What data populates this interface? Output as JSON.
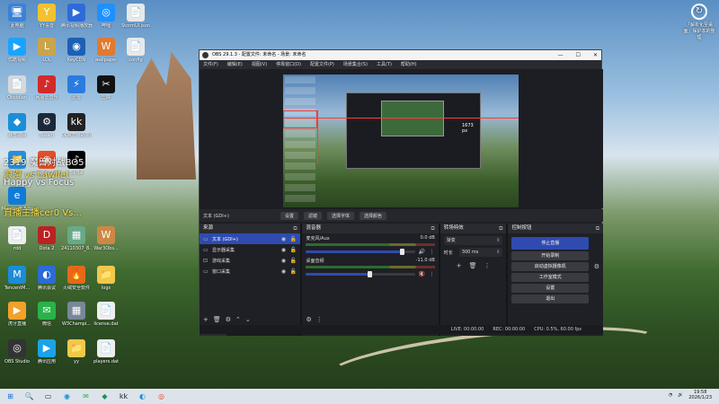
{
  "desktop": {
    "icons": [
      {
        "label": "此电脑",
        "glyph": "🖥",
        "color": "#3b82d6"
      },
      {
        "label": "YY语音",
        "glyph": "Y",
        "color": "#f2c230"
      },
      {
        "label": "腾讯视频播放器",
        "glyph": "▶",
        "color": "#2f6bd8"
      },
      {
        "label": "哔哩",
        "glyph": "◎",
        "color": "#1e90ff"
      },
      {
        "label": "StormUI.json",
        "glyph": "📄",
        "color": "#e8e8e8"
      },
      {
        "label": "优酷视频",
        "glyph": "▶",
        "color": "#1aa3ff"
      },
      {
        "label": "LOL",
        "glyph": "L",
        "color": "#c9a44a"
      },
      {
        "label": "KeyCDN",
        "glyph": "◉",
        "color": "#1d5fb5"
      },
      {
        "label": "wallpaper",
        "glyph": "W",
        "color": "#e07a2f"
      },
      {
        "label": "config",
        "glyph": "📄",
        "color": "#e8e8e8"
      },
      {
        "label": "Obsidian",
        "glyph": "📄",
        "color": "#d8d8d8"
      },
      {
        "label": "网易云音乐",
        "glyph": "♪",
        "color": "#d22a2a"
      },
      {
        "label": "迅雷",
        "glyph": "⚡",
        "color": "#2a7be0"
      },
      {
        "label": "剪映",
        "glyph": "✂",
        "color": "#111"
      },
      {
        "label": "暴雪战网",
        "glyph": "◆",
        "color": "#1a8fd8"
      },
      {
        "label": "Steam",
        "glyph": "⚙",
        "color": "#1b2838"
      },
      {
        "label": "KK官方对战平台",
        "glyph": "kk",
        "color": "#222"
      },
      {
        "label": "文件",
        "glyph": "📁",
        "color": "#2a8cd8"
      },
      {
        "label": "Google Chrome",
        "glyph": "◉",
        "color": "#e44d26"
      },
      {
        "label": "TikTok",
        "glyph": "♪",
        "color": "#000"
      },
      {
        "label": "Microsoft Edge",
        "glyph": "e",
        "color": "#0f7bd8"
      },
      {
        "label": "rdd",
        "glyph": "📄",
        "color": "#eee"
      },
      {
        "label": "Dota 2",
        "glyph": "D",
        "color": "#b22"
      },
      {
        "label": "24110307_8...",
        "glyph": "▦",
        "color": "#6a8"
      },
      {
        "label": "War3Obs...",
        "glyph": "W",
        "color": "#c84"
      },
      {
        "label": "TencentM...",
        "glyph": "M",
        "color": "#1a8cd8"
      },
      {
        "label": "腾讯会议",
        "glyph": "◐",
        "color": "#2a6bd8"
      },
      {
        "label": "火绒安全软件",
        "glyph": "🔥",
        "color": "#e46a1a"
      },
      {
        "label": "logs",
        "glyph": "📁",
        "color": "#f2c84b"
      },
      {
        "label": "虎牙直播",
        "glyph": "▶",
        "color": "#f2a12a"
      },
      {
        "label": "微信",
        "glyph": "✉",
        "color": "#2ab24a"
      },
      {
        "label": "W3Champi...",
        "glyph": "▦",
        "color": "#789"
      },
      {
        "label": "license.dat",
        "glyph": "📄",
        "color": "#eee"
      },
      {
        "label": "OBS Studio",
        "glyph": "◎",
        "color": "#333"
      },
      {
        "label": "腾讯应用",
        "glyph": "▶",
        "color": "#1aa3e8"
      },
      {
        "label": "yy",
        "glyph": "📁",
        "color": "#f2c84b"
      },
      {
        "label": "players.dat",
        "glyph": "📄",
        "color": "#eee"
      }
    ],
    "overlay_lines": [
      "2319 魔兽对战BO5",
      "浪漫 vs Lawliet",
      "Happy vs Focus",
      "直播主播cer0 Vs..."
    ],
    "recycle_bin": {
      "label": "「解析化至桌面」保护本的整理",
      "glyph": "↻"
    }
  },
  "obs": {
    "title": "OBS 29.1.3 - 配置文件: 未命名 - 场景: 未命名",
    "window_controls": [
      "—",
      "☐",
      "✕"
    ],
    "menu": [
      "文件(F)",
      "编辑(E)",
      "视图(V)",
      "停靠窗口(D)",
      "配置文件(P)",
      "场景集合(S)",
      "工具(T)",
      "帮助(H)"
    ],
    "preview_px_label": "1673 px",
    "source_toolbar": {
      "source_name": "文本 (GDI+)",
      "buttons": [
        "设置",
        "滤镜",
        "选择字体",
        "选择颜色"
      ]
    },
    "sources": {
      "title": "来源",
      "items": [
        {
          "name": "文本 (GDI+)",
          "icon": "text-icon",
          "glyph": "▭",
          "selected": true
        },
        {
          "name": "显示器采集",
          "icon": "monitor-icon",
          "glyph": "▭",
          "selected": false
        },
        {
          "name": "游戏采集",
          "icon": "gamepad-icon",
          "glyph": "⊡",
          "selected": false
        },
        {
          "name": "窗口采集",
          "icon": "window-icon",
          "glyph": "▭",
          "selected": false
        }
      ],
      "footer_buttons": [
        "+",
        "🗑",
        "⚙",
        "⌃",
        "⌄"
      ]
    },
    "dock_tabs": [
      "来源",
      "场景"
    ],
    "mixer": {
      "title": "混音器",
      "channels": [
        {
          "name": "麦克风/Aux",
          "db": "0.0 dB",
          "volume": 0.88,
          "muted": false
        },
        {
          "name": "桌面音频",
          "db": "-11.0 dB",
          "volume": 0.58,
          "muted": true
        }
      ]
    },
    "transitions": {
      "title": "转场特效",
      "type": "渐变",
      "duration_label": "时长",
      "duration": "300 ms"
    },
    "controls": {
      "title": "控制按钮",
      "buttons": [
        "停止直播",
        "开始录制",
        "启动虚拟摄像机",
        "工作室模式",
        "设置",
        "退出"
      ]
    },
    "status": {
      "live": "LIVE: 00:00:00",
      "rec": "REC: 00:00:00",
      "cpu": "CPU: 0.5%, 60.00 fps"
    }
  },
  "taskbar": {
    "apps": [
      "⊞",
      "🔍",
      "▭",
      "◉",
      "✉",
      "◆",
      "kk",
      "◐",
      "◎"
    ],
    "time": "19:58",
    "date": "2026/1/23"
  }
}
